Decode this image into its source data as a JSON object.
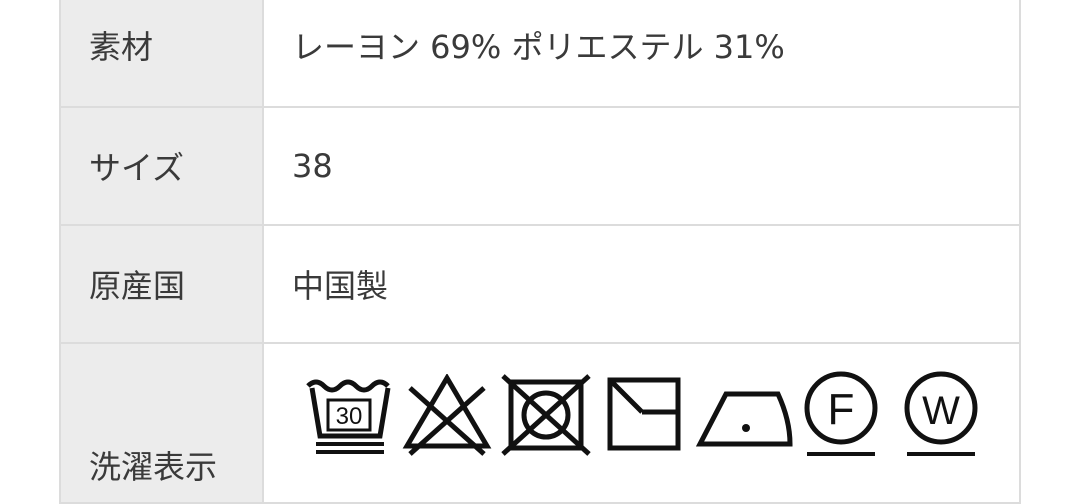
{
  "rows": [
    {
      "label": "素材",
      "value": "レーヨン 69% ポリエステル 31%"
    },
    {
      "label": "サイズ",
      "value": "38"
    },
    {
      "label": "原産国",
      "value": "中国製"
    },
    {
      "label": "洗濯表示",
      "value": ""
    }
  ],
  "care_symbols": [
    {
      "name": "wash-30-icon",
      "text": "30"
    },
    {
      "name": "no-bleach-icon"
    },
    {
      "name": "no-tumble-dry-icon"
    },
    {
      "name": "shade-dry-icon"
    },
    {
      "name": "iron-low-icon"
    },
    {
      "name": "dryclean-f-icon",
      "text": "F"
    },
    {
      "name": "wetclean-w-icon",
      "text": "W"
    }
  ]
}
